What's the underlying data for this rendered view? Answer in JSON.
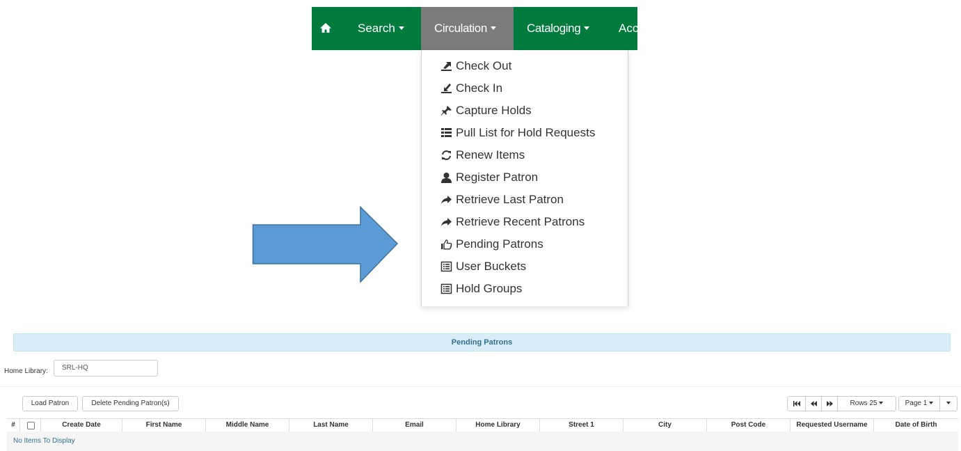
{
  "nav": {
    "home_icon": "home-icon",
    "search_label": "Search",
    "circulation_label": "Circulation",
    "cataloging_label": "Cataloging",
    "acquisitions_label": "Acc",
    "bar_color": "#007a3d",
    "active_color": "#7b7b7b"
  },
  "circulation_menu": {
    "items": [
      {
        "label": "Check Out",
        "icon": "check-out-icon"
      },
      {
        "label": "Check In",
        "icon": "check-in-icon"
      },
      {
        "label": "Capture Holds",
        "icon": "pushpin-icon"
      },
      {
        "label": "Pull List for Hold Requests",
        "icon": "list-icon"
      },
      {
        "label": "Renew Items",
        "icon": "refresh-icon"
      },
      {
        "label": "Register Patron",
        "icon": "user-icon"
      },
      {
        "label": "Retrieve Last Patron",
        "icon": "share-arrow-icon"
      },
      {
        "label": "Retrieve Recent Patrons",
        "icon": "share-arrow-icon"
      },
      {
        "label": "Pending Patrons",
        "icon": "thumbs-up-icon"
      },
      {
        "label": "User Buckets",
        "icon": "list-alt-icon"
      },
      {
        "label": "Hold Groups",
        "icon": "list-alt-icon"
      }
    ]
  },
  "annotation": {
    "arrow_color": "#5b9bd5",
    "arrow_border": "#41719c"
  },
  "pending_patrons": {
    "title": "Pending Patrons",
    "home_library_label": "Home Library:",
    "home_library_value": "SRL-HQ",
    "load_button": "Load Patron",
    "delete_button": "Delete Pending Patron(s)",
    "pager": {
      "rows_label": "Rows 25",
      "page_label": "Page 1"
    },
    "columns": [
      "#",
      "",
      "Create Date",
      "First Name",
      "Middle Name",
      "Last Name",
      "Email",
      "Home Library",
      "Street 1",
      "City",
      "Post Code",
      "Requested Username",
      "Date of Birth"
    ],
    "empty_message": "No Items To Display"
  }
}
